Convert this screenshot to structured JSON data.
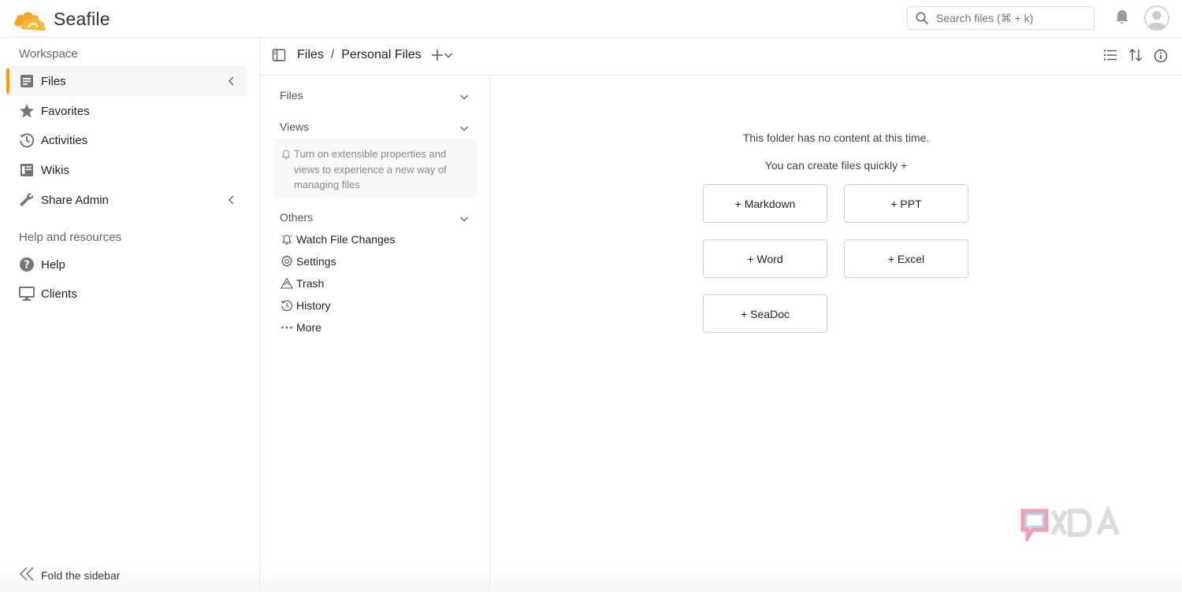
{
  "app": {
    "name": "Seafile"
  },
  "search": {
    "placeholder": "Search files (⌘ + k)"
  },
  "sidebar": {
    "workspace_heading": "Workspace",
    "items": [
      {
        "label": "Files",
        "icon": "files-icon",
        "active": true
      },
      {
        "label": "Favorites",
        "icon": "star-icon"
      },
      {
        "label": "Activities",
        "icon": "activity-icon"
      },
      {
        "label": "Wikis",
        "icon": "wiki-icon"
      },
      {
        "label": "Share Admin",
        "icon": "wrench-icon"
      }
    ],
    "help_heading": "Help and resources",
    "help_items": [
      {
        "label": "Help",
        "icon": "help-icon"
      },
      {
        "label": "Clients",
        "icon": "monitor-icon"
      }
    ],
    "fold_label": "Fold the sidebar"
  },
  "breadcrumb": {
    "root": "Files",
    "separator": "/",
    "current": "Personal Files"
  },
  "tree": {
    "sections": {
      "files": "Files",
      "views": "Views",
      "others": "Others"
    },
    "views_tip": "Turn on extensible properties and views to experience a new way of managing files",
    "others_items": [
      {
        "label": "Watch File Changes",
        "icon": "watch-icon"
      },
      {
        "label": "Settings",
        "icon": "gear-icon"
      },
      {
        "label": "Trash",
        "icon": "trash-icon"
      },
      {
        "label": "History",
        "icon": "history-icon"
      },
      {
        "label": "More",
        "icon": "more-icon"
      }
    ]
  },
  "main": {
    "empty_message": "This folder has no content at this time.",
    "create_hint": "You can create files quickly +",
    "buttons": {
      "markdown": "+ Markdown",
      "ppt": "+ PPT",
      "word": "+ Word",
      "excel": "+ Excel",
      "seadoc": "+ SeaDoc"
    }
  },
  "watermark": {
    "text": "XDA"
  },
  "colors": {
    "accent": "#ff9800",
    "logo_orange": "#f6a623",
    "border": "#e9e9e9"
  }
}
